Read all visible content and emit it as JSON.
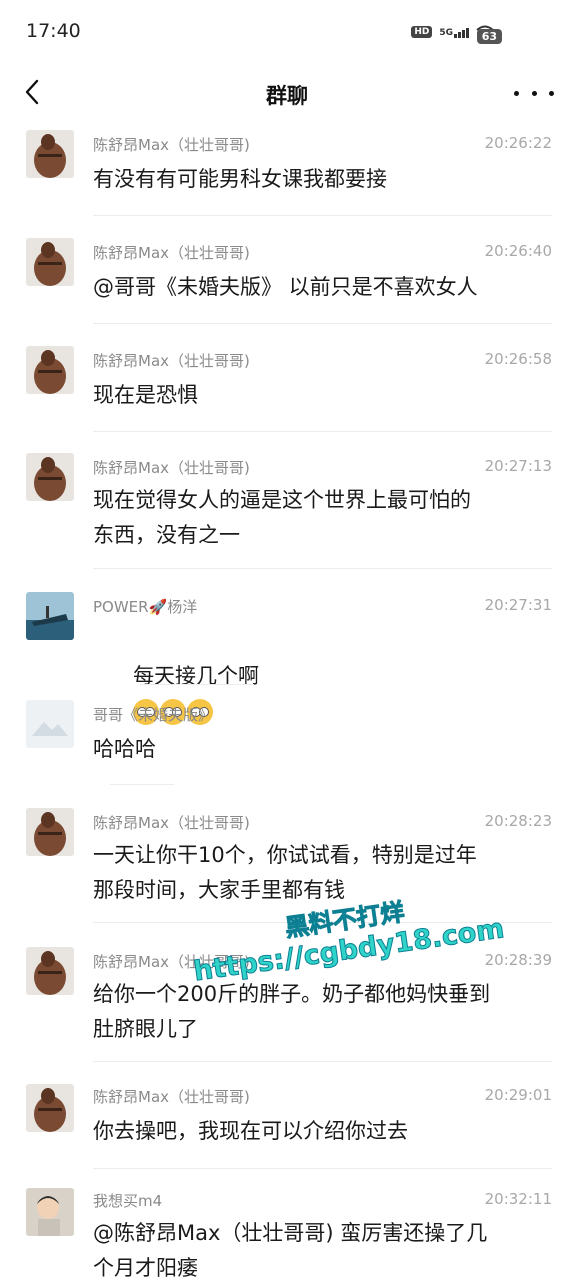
{
  "status_bar": {
    "time": "17:40",
    "hd": "HD",
    "network": "5G",
    "battery": "63"
  },
  "header": {
    "title": "群聊",
    "back_icon": "chevron-left-icon",
    "more_icon": "more-dots-icon"
  },
  "messages": [
    {
      "sender": "陈舒昂Max（壮壮哥哥)",
      "time": "20:26:22",
      "text": "有没有有可能男科女课我都要接",
      "avatar": "muscle-man-photo"
    },
    {
      "sender": "陈舒昂Max（壮壮哥哥)",
      "time": "20:26:40",
      "text": "@哥哥《未婚夫版》 以前只是不喜欢女人",
      "avatar": "muscle-man-photo"
    },
    {
      "sender": "陈舒昂Max（壮壮哥哥)",
      "time": "20:26:58",
      "text": "现在是恐惧",
      "avatar": "muscle-man-photo"
    },
    {
      "sender": "陈舒昂Max（壮壮哥哥)",
      "time": "20:27:13",
      "text": "现在觉得女人的逼是这个世界上最可怕的\n东西，没有之一",
      "avatar": "muscle-man-photo"
    },
    {
      "sender": "POWER🚀杨洋",
      "time": "20:27:31",
      "text": "每天接几个啊",
      "emoji_count": 3,
      "avatar": "ship-photo"
    },
    {
      "sender": "哥哥《未婚夫版》",
      "time": "",
      "text": "哈哈哈",
      "avatar": "blank-placeholder"
    },
    {
      "sender": "陈舒昂Max（壮壮哥哥)",
      "time": "20:28:23",
      "text": "一天让你干10个，你试试看，特别是过年\n那段时间，大家手里都有钱",
      "avatar": "muscle-man-photo"
    },
    {
      "sender": "陈舒昂Max（壮壮哥哥)",
      "time": "20:28:39",
      "text": "给你一个200斤的胖子。奶子都他妈快垂到\n肚脐眼儿了",
      "avatar": "muscle-man-photo"
    },
    {
      "sender": "陈舒昂Max（壮壮哥哥)",
      "time": "20:29:01",
      "text": "你去操吧，我现在可以介绍你过去",
      "avatar": "muscle-man-photo"
    },
    {
      "sender": "我想买m4",
      "time": "20:32:11",
      "text": "@陈舒昂Max（壮壮哥哥) 蛮厉害还操了几\n个月才阳痿",
      "avatar": "child-photo"
    }
  ],
  "watermark": {
    "line1": "黑料不打烊",
    "line2": "https://cgbdy18.com"
  }
}
